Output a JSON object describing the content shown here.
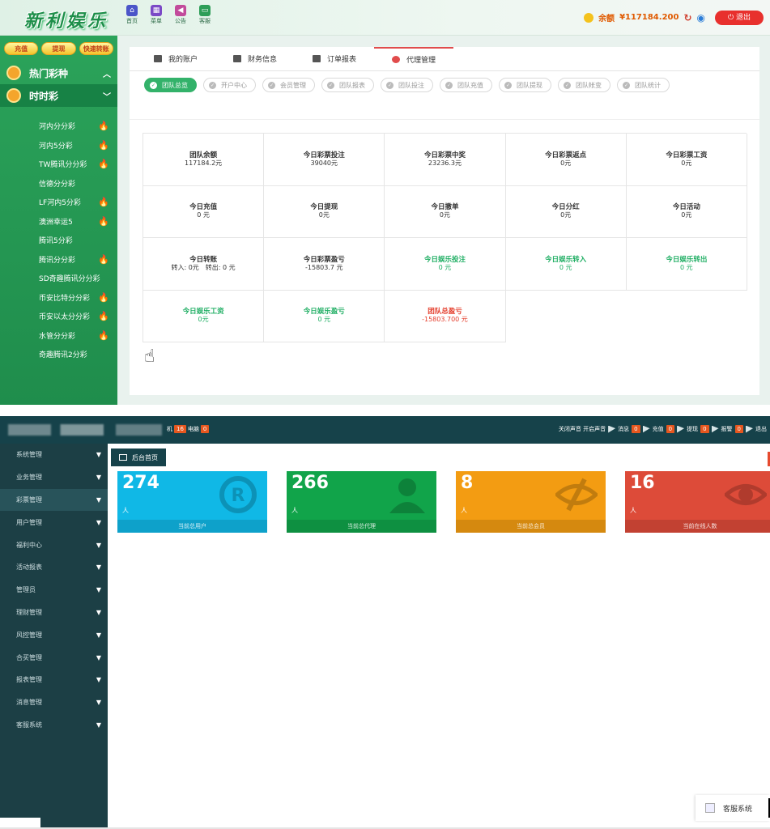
{
  "top": {
    "logo": "新利娱乐",
    "nav": [
      "首页",
      "菜单",
      "公告",
      "客服"
    ],
    "balance_label": "余额",
    "balance_value": "¥117184.200",
    "logout": "退出",
    "quick_buttons": [
      "充值",
      "提现",
      "快速转账"
    ],
    "categories": [
      "热门彩种",
      "时时彩"
    ],
    "lotteries": [
      {
        "name": "河内分分彩",
        "hot": true
      },
      {
        "name": "河内5分彩",
        "hot": true
      },
      {
        "name": "TW腾讯分分彩",
        "hot": true
      },
      {
        "name": "信德分分彩",
        "hot": false
      },
      {
        "name": "LF河内5分彩",
        "hot": true
      },
      {
        "name": "澳洲幸运5",
        "hot": true
      },
      {
        "name": "腾讯5分彩",
        "hot": false
      },
      {
        "name": "腾讯分分彩",
        "hot": true
      },
      {
        "name": "SD奇趣腾讯分分彩",
        "hot": false
      },
      {
        "name": "币安比特分分彩",
        "hot": true
      },
      {
        "name": "币安以太分分彩",
        "hot": true
      },
      {
        "name": "水管分分彩",
        "hot": true
      },
      {
        "name": "奇趣腾讯2分彩",
        "hot": false
      }
    ],
    "main_tabs": [
      "我的账户",
      "财务信息",
      "订单报表",
      "代理管理"
    ],
    "sub_tabs": [
      "团队总览",
      "开户中心",
      "会员管理",
      "团队报表",
      "团队投注",
      "团队充值",
      "团队提现",
      "团队帐变",
      "团队统计"
    ],
    "stats": [
      {
        "label": "团队余额",
        "value": "117184.2元",
        "tone": "normal"
      },
      {
        "label": "今日彩票投注",
        "value": "39040元",
        "tone": "normal"
      },
      {
        "label": "今日彩票中奖",
        "value": "23236.3元",
        "tone": "normal"
      },
      {
        "label": "今日彩票返点",
        "value": "0元",
        "tone": "normal"
      },
      {
        "label": "今日彩票工资",
        "value": "0元",
        "tone": "normal"
      },
      {
        "label": "今日充值",
        "value": "0 元",
        "tone": "normal"
      },
      {
        "label": "今日提现",
        "value": "0元",
        "tone": "normal"
      },
      {
        "label": "今日撤单",
        "value": "0元",
        "tone": "normal"
      },
      {
        "label": "今日分红",
        "value": "0元",
        "tone": "normal"
      },
      {
        "label": "今日活动",
        "value": "0元",
        "tone": "normal"
      },
      {
        "label": "今日转账",
        "value": "转入: 0元　转出: 0 元",
        "tone": "normal"
      },
      {
        "label": "今日彩票盈亏",
        "value": "-15803.7 元",
        "tone": "normal"
      },
      {
        "label": "今日娱乐投注",
        "value": "0 元",
        "tone": "green"
      },
      {
        "label": "今日娱乐转入",
        "value": "0 元",
        "tone": "green"
      },
      {
        "label": "今日娱乐转出",
        "value": "0 元",
        "tone": "green"
      },
      {
        "label": "今日娱乐工资",
        "value": "0元",
        "tone": "green"
      },
      {
        "label": "今日娱乐盈亏",
        "value": "0 元",
        "tone": "green"
      },
      {
        "label": "团队总盈亏",
        "value": "-15803.700 元",
        "tone": "red"
      }
    ]
  },
  "admin": {
    "online_prefix": "机",
    "online_count": "16",
    "pc_label": "电脑",
    "pc_count": "0",
    "right_items": [
      {
        "label": "关闭声音 开启声音",
        "count": null
      },
      {
        "label": "消息",
        "count": "0"
      },
      {
        "label": "充值",
        "count": "0"
      },
      {
        "label": "提现",
        "count": "0"
      },
      {
        "label": "报警",
        "count": "0"
      },
      {
        "label": "退出",
        "count": null
      }
    ],
    "menu": [
      "系统管理",
      "业务管理",
      "彩票管理",
      "用户管理",
      "福利中心",
      "活动报表",
      "管理员",
      "理财管理",
      "风控管理",
      "合买管理",
      "报表管理",
      "消息管理",
      "客服系统"
    ],
    "home_tab": "后台首页",
    "cards": [
      {
        "num": "274",
        "unit": "人",
        "foot": "当前总用户",
        "icon": "registered-icon"
      },
      {
        "num": "266",
        "unit": "人",
        "foot": "当前总代理",
        "icon": "user-icon"
      },
      {
        "num": "8",
        "unit": "人",
        "foot": "当前总会员",
        "icon": "eye-slash-icon"
      },
      {
        "num": "16",
        "unit": "人",
        "foot": "当前在线人数",
        "icon": "eye-icon"
      }
    ],
    "cs_widget": "客服系统"
  }
}
